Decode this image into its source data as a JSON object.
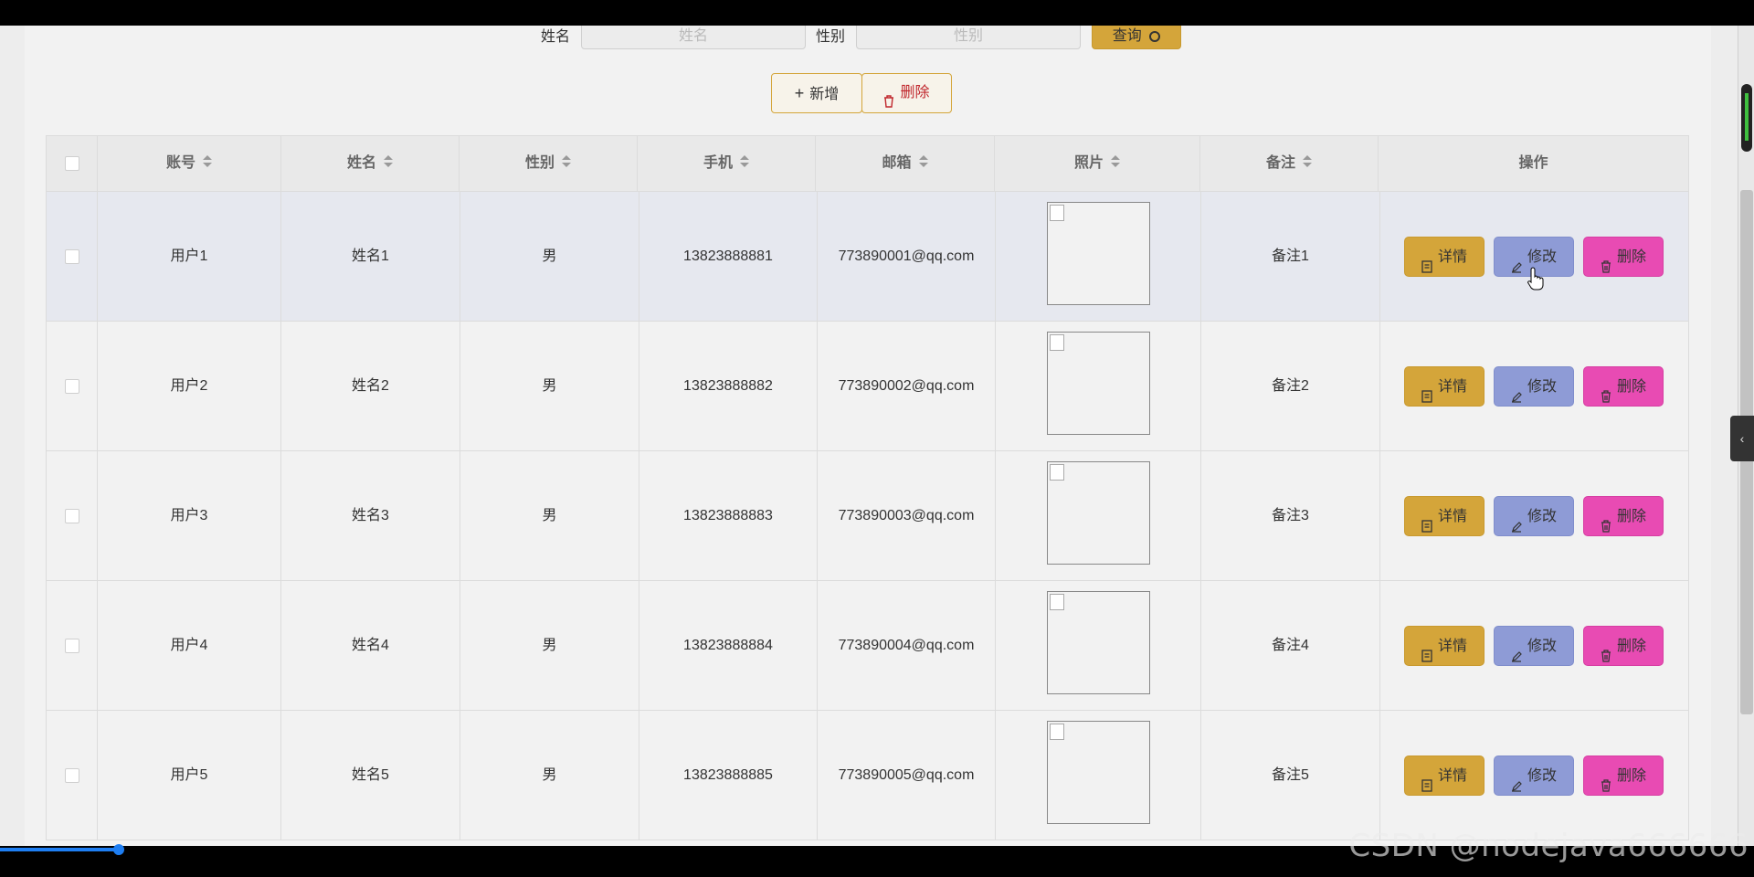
{
  "search": {
    "name_label": "姓名",
    "name_placeholder": "姓名",
    "gender_label": "性别",
    "gender_placeholder": "性别",
    "query_label": "查询"
  },
  "actions": {
    "add_label": "新增",
    "batch_delete_label": "删除"
  },
  "table": {
    "columns": [
      "账号",
      "姓名",
      "性别",
      "手机",
      "邮箱",
      "照片",
      "备注",
      "操作"
    ],
    "rows": [
      {
        "account": "用户1",
        "name": "姓名1",
        "gender": "男",
        "phone": "13823888881",
        "email": "773890001@qq.com",
        "remark": "备注1"
      },
      {
        "account": "用户2",
        "name": "姓名2",
        "gender": "男",
        "phone": "13823888882",
        "email": "773890002@qq.com",
        "remark": "备注2"
      },
      {
        "account": "用户3",
        "name": "姓名3",
        "gender": "男",
        "phone": "13823888883",
        "email": "773890003@qq.com",
        "remark": "备注3"
      },
      {
        "account": "用户4",
        "name": "姓名4",
        "gender": "男",
        "phone": "13823888884",
        "email": "773890004@qq.com",
        "remark": "备注4"
      },
      {
        "account": "用户5",
        "name": "姓名5",
        "gender": "男",
        "phone": "13823888885",
        "email": "773890005@qq.com",
        "remark": "备注5"
      }
    ],
    "row_actions": {
      "detail_label": "详情",
      "edit_label": "修改",
      "delete_label": "删除"
    }
  },
  "colors": {
    "detail": "#d4a53a",
    "edit": "#8e9bd6",
    "delete": "#e84bb3",
    "accent": "#d4a53a"
  },
  "watermark": "CSDN @nodejava666666"
}
